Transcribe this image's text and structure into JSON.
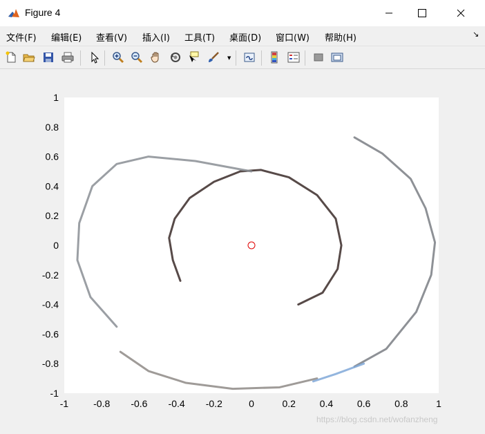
{
  "window": {
    "title": "Figure 4"
  },
  "menu": [
    "文件(F)",
    "编辑(E)",
    "查看(V)",
    "插入(I)",
    "工具(T)",
    "桌面(D)",
    "窗口(W)",
    "帮助(H)"
  ],
  "toolbar": {
    "icons": [
      "new-figure-icon",
      "open-file-icon",
      "save-icon",
      "print-icon",
      "pointer-icon",
      "zoom-in-icon",
      "zoom-out-icon",
      "pan-hand-icon",
      "rotate-3d-icon",
      "data-cursor-icon",
      "brush-icon",
      "link-plot-icon",
      "colorbar-icon",
      "legend-icon",
      "hide-plot-tools-icon",
      "show-plot-tools-icon"
    ]
  },
  "chart_data": {
    "type": "scatter",
    "xlim": [
      -1,
      1
    ],
    "ylim": [
      -1,
      1
    ],
    "xticks": [
      "-1",
      "-0.8",
      "-0.6",
      "-0.4",
      "-0.2",
      "0",
      "0.2",
      "0.4",
      "0.6",
      "0.8",
      "1"
    ],
    "yticks": [
      "1",
      "0.8",
      "0.6",
      "0.4",
      "0.2",
      "0",
      "-0.2",
      "-0.4",
      "-0.6",
      "-0.8",
      "-1"
    ],
    "grid": false,
    "marker": {
      "x": 0,
      "y": 0,
      "shape": "circle",
      "color": "#e00000"
    },
    "description_series": [
      {
        "name": "",
        "color": "#3a2a28",
        "points": [
          [
            -0.38,
            -0.24
          ],
          [
            -0.42,
            -0.1
          ],
          [
            -0.44,
            0.05
          ],
          [
            -0.41,
            0.18
          ],
          [
            -0.33,
            0.32
          ],
          [
            -0.2,
            0.43
          ],
          [
            -0.06,
            0.5
          ],
          [
            0.05,
            0.51
          ],
          [
            0.2,
            0.46
          ],
          [
            0.35,
            0.34
          ],
          [
            0.45,
            0.18
          ],
          [
            0.48,
            0.0
          ],
          [
            0.46,
            -0.16
          ],
          [
            0.38,
            -0.32
          ],
          [
            0.25,
            -0.4
          ]
        ]
      },
      {
        "name": "",
        "color": "#8a8e94",
        "points": [
          [
            -0.72,
            -0.55
          ],
          [
            -0.86,
            -0.35
          ],
          [
            -0.93,
            -0.1
          ],
          [
            -0.92,
            0.15
          ],
          [
            -0.85,
            0.4
          ],
          [
            -0.72,
            0.55
          ],
          [
            -0.55,
            0.6
          ],
          [
            -0.3,
            0.57
          ],
          [
            0.0,
            0.5
          ]
        ]
      },
      {
        "name": "",
        "color": "#7a7e84",
        "points": [
          [
            0.55,
            0.73
          ],
          [
            0.7,
            0.62
          ],
          [
            0.85,
            0.45
          ],
          [
            0.93,
            0.25
          ],
          [
            0.98,
            0.02
          ],
          [
            0.96,
            -0.2
          ],
          [
            0.88,
            -0.45
          ],
          [
            0.72,
            -0.7
          ],
          [
            0.55,
            -0.82
          ]
        ]
      },
      {
        "name": "",
        "color": "#8e8a86",
        "points": [
          [
            -0.7,
            -0.72
          ],
          [
            -0.55,
            -0.85
          ],
          [
            -0.35,
            -0.93
          ],
          [
            -0.1,
            -0.97
          ],
          [
            0.15,
            -0.96
          ],
          [
            0.35,
            -0.9
          ]
        ]
      },
      {
        "name": "",
        "color": "#80a8d8",
        "points": [
          [
            0.33,
            -0.92
          ],
          [
            0.45,
            -0.87
          ],
          [
            0.6,
            -0.8
          ]
        ]
      }
    ]
  },
  "watermark": "https://blog.csdn.net/wofanzheng"
}
